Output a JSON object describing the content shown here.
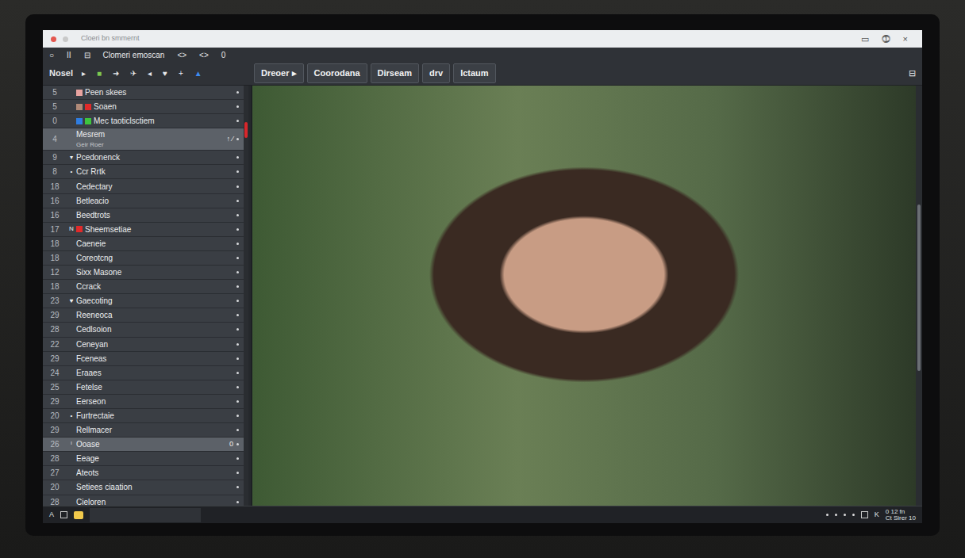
{
  "window": {
    "title": "Cloeri bn smmernt",
    "controls": [
      "▭",
      "⓵",
      "×"
    ]
  },
  "toolbar": {
    "icons": [
      "○",
      "II",
      "⊟"
    ],
    "label": "Clomeri emoscan",
    "nav": [
      "<>",
      "<>"
    ],
    "counter": "0"
  },
  "toolbar2": {
    "label": "Nosel",
    "tools": [
      {
        "glyph": "▸",
        "color": "#e6e8ea"
      },
      {
        "glyph": "■",
        "color": "#7ec850"
      },
      {
        "glyph": "➜",
        "color": "#e6e8ea"
      },
      {
        "glyph": "✈",
        "color": "#e6e8ea"
      },
      {
        "glyph": "◂",
        "color": "#e6e8ea"
      },
      {
        "glyph": "♥",
        "color": "#e6e8ea"
      },
      {
        "glyph": "+",
        "color": "#e6e8ea"
      },
      {
        "glyph": "▲",
        "color": "#3d8bf0"
      }
    ],
    "end_icon": "⊟"
  },
  "tabs": [
    {
      "label": "Dreoer ▸",
      "selected": false
    },
    {
      "label": "Coorodana",
      "selected": false
    },
    {
      "label": "Dirseam",
      "selected": false
    },
    {
      "label": "drv",
      "selected": false
    },
    {
      "label": "Ictaum",
      "selected": false
    }
  ],
  "sidebar": {
    "items": [
      {
        "number": "5",
        "label": "Peen skees",
        "marker": "",
        "sub": "",
        "extra": "",
        "selected": false,
        "colors": [
          "#e8a3a0"
        ]
      },
      {
        "number": "5",
        "label": "Soaen",
        "marker": "",
        "sub": "",
        "extra": "",
        "selected": false,
        "colors": [
          "#b08a78",
          "#e02a2a"
        ]
      },
      {
        "number": "0",
        "label": "Mec taoticlsctiem",
        "marker": "",
        "sub": "",
        "extra": "",
        "selected": false,
        "colors": [
          "#2f7de1",
          "#3ec43e"
        ]
      },
      {
        "number": "4",
        "label": "Mesrem",
        "marker": "",
        "sub": "Geir Roer",
        "extra": "↑ ⁄",
        "selected": true,
        "colors": []
      },
      {
        "number": "9",
        "label": "Pcedonenck",
        "marker": "▾",
        "sub": "",
        "extra": "",
        "selected": false,
        "colors": []
      },
      {
        "number": "8",
        "label": "Ccr Rrtk",
        "marker": "•",
        "sub": "",
        "extra": "",
        "selected": false,
        "colors": []
      },
      {
        "number": "18",
        "label": "Cedectary",
        "marker": "",
        "sub": "",
        "extra": "",
        "selected": false,
        "colors": []
      },
      {
        "number": "16",
        "label": "Betleacio",
        "marker": "",
        "sub": "",
        "extra": "",
        "selected": false,
        "colors": []
      },
      {
        "number": "16",
        "label": "Beedtrots",
        "marker": "",
        "sub": "",
        "extra": "",
        "selected": false,
        "colors": []
      },
      {
        "number": "17",
        "label": "Sheemsetiae",
        "marker": "N",
        "sub": "",
        "extra": "",
        "selected": false,
        "colors": [
          "#e02a2a"
        ]
      },
      {
        "number": "18",
        "label": "Caeneie",
        "marker": "",
        "sub": "",
        "extra": "",
        "selected": false,
        "colors": []
      },
      {
        "number": "18",
        "label": "Coreotcng",
        "marker": "",
        "sub": "",
        "extra": "",
        "selected": false,
        "colors": []
      },
      {
        "number": "12",
        "label": "Sixx Masone",
        "marker": "",
        "sub": "",
        "extra": "",
        "selected": false,
        "colors": []
      },
      {
        "number": "18",
        "label": "Ccrack",
        "marker": "",
        "sub": "",
        "extra": "",
        "selected": false,
        "colors": []
      },
      {
        "number": "23",
        "label": "Gaecoting",
        "marker": "♥",
        "sub": "",
        "extra": "",
        "selected": false,
        "colors": []
      },
      {
        "number": "29",
        "label": "Reeneoca",
        "marker": "",
        "sub": "",
        "extra": "",
        "selected": false,
        "colors": []
      },
      {
        "number": "28",
        "label": "Cedlsoion",
        "marker": "",
        "sub": "",
        "extra": "",
        "selected": false,
        "colors": []
      },
      {
        "number": "22",
        "label": "Ceneyan",
        "marker": "",
        "sub": "",
        "extra": "",
        "selected": false,
        "colors": []
      },
      {
        "number": "29",
        "label": "Fceneas",
        "marker": "",
        "sub": "",
        "extra": "",
        "selected": false,
        "colors": []
      },
      {
        "number": "24",
        "label": "Eraaes",
        "marker": "",
        "sub": "",
        "extra": "",
        "selected": false,
        "colors": []
      },
      {
        "number": "25",
        "label": "Fetelse",
        "marker": "",
        "sub": "",
        "extra": "",
        "selected": false,
        "colors": []
      },
      {
        "number": "29",
        "label": "Eerseon",
        "marker": "",
        "sub": "",
        "extra": "",
        "selected": false,
        "colors": []
      },
      {
        "number": "20",
        "label": "Furtrectaie",
        "marker": "•",
        "sub": "",
        "extra": "",
        "selected": false,
        "colors": []
      },
      {
        "number": "29",
        "label": "Rellmacer",
        "marker": "",
        "sub": "",
        "extra": "",
        "selected": false,
        "colors": []
      },
      {
        "number": "26",
        "label": "Ooase",
        "marker": "ᴵ",
        "sub": "",
        "extra": "0",
        "selected": true,
        "colors": []
      },
      {
        "number": "28",
        "label": "Eeage",
        "marker": "",
        "sub": "",
        "extra": "",
        "selected": false,
        "colors": []
      },
      {
        "number": "27",
        "label": "Ateots",
        "marker": "",
        "sub": "",
        "extra": "",
        "selected": false,
        "colors": []
      },
      {
        "number": "20",
        "label": "Setiees ciaation",
        "marker": "",
        "sub": "",
        "extra": "",
        "selected": false,
        "colors": []
      },
      {
        "number": "28",
        "label": "Cieloren",
        "marker": "",
        "sub": "",
        "extra": "",
        "selected": false,
        "colors": []
      }
    ]
  },
  "taskbar": {
    "start": "A",
    "status_icon": "K",
    "status_top": "0 12 fn",
    "status_bottom": "Ct Sirer 10"
  }
}
